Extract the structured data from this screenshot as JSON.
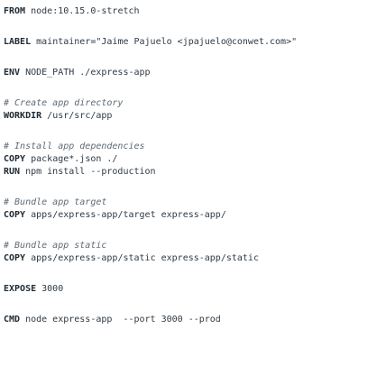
{
  "dockerfile": {
    "from": {
      "kw": "FROM",
      "text": " node:10.15.0-stretch"
    },
    "label": {
      "kw": "LABEL",
      "text": " maintainer=\"Jaime Pajuelo <jpajuelo@conwet.com>\""
    },
    "env": {
      "kw": "ENV",
      "text": " NODE_PATH ./express-app"
    },
    "comment_create": "# Create app directory",
    "workdir": {
      "kw": "WORKDIR",
      "text": " /usr/src/app"
    },
    "comment_install": "# Install app dependencies",
    "copy_package": {
      "kw": "COPY",
      "text": " package*.json ./"
    },
    "run_install": {
      "kw": "RUN",
      "text": " npm install --production"
    },
    "comment_target": "# Bundle app target",
    "copy_target": {
      "kw": "COPY",
      "text": " apps/express-app/target express-app/"
    },
    "comment_static": "# Bundle app static",
    "copy_static": {
      "kw": "COPY",
      "text": " apps/express-app/static express-app/static"
    },
    "expose": {
      "kw": "EXPOSE",
      "text": " 3000"
    },
    "cmd": {
      "kw": "CMD",
      "text": " node express-app  --port 3000 --prod"
    }
  }
}
